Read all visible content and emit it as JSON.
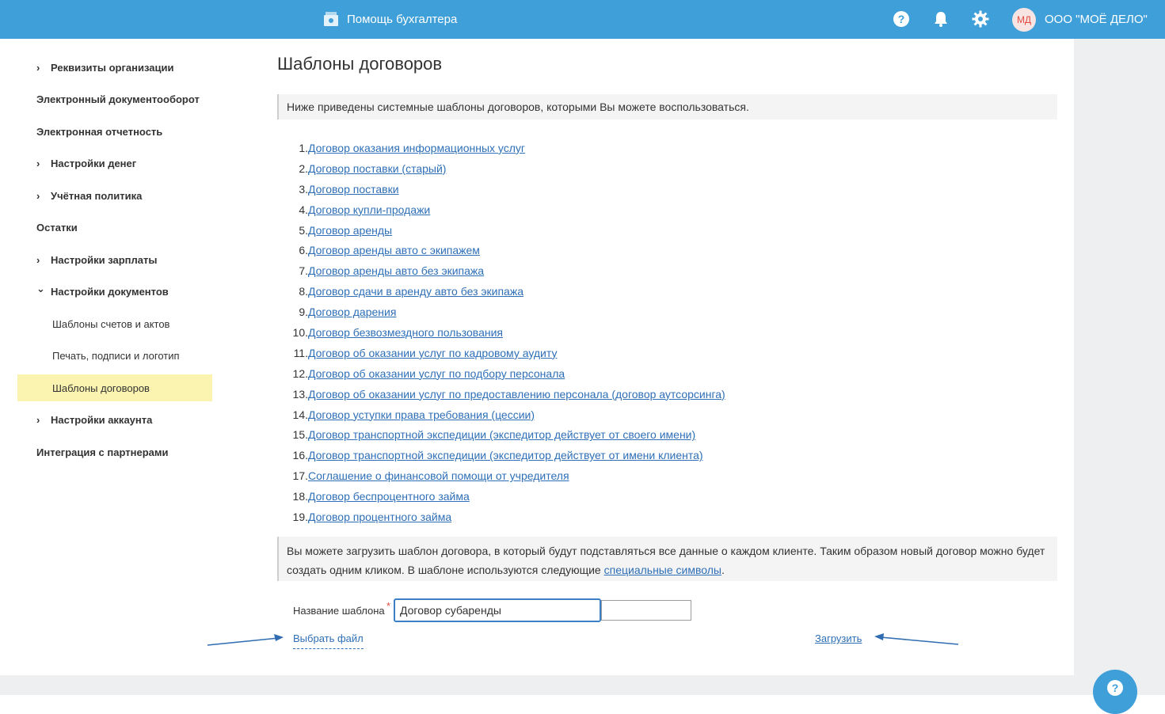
{
  "header": {
    "help_label": "Помощь бухгалтера",
    "avatar_text": "МД",
    "org_name": "ООО \"МОЁ ДЕЛО\"",
    "icons": [
      "help-book-icon",
      "question-circle-icon",
      "bell-icon",
      "gear-icon"
    ],
    "accent": "#3f9fd9"
  },
  "sidebar": {
    "items": [
      {
        "label": "Реквизиты организации",
        "kind": "group"
      },
      {
        "label": "Электронный документооборот",
        "kind": "top"
      },
      {
        "label": "Электронная отчетность",
        "kind": "top"
      },
      {
        "label": "Настройки денег",
        "kind": "group"
      },
      {
        "label": "Учётная политика",
        "kind": "group"
      },
      {
        "label": "Остатки",
        "kind": "top"
      },
      {
        "label": "Настройки зарплаты",
        "kind": "group"
      },
      {
        "label": "Настройки документов",
        "kind": "group-open"
      },
      {
        "label": "Шаблоны счетов и актов",
        "kind": "sub"
      },
      {
        "label": "Печать, подписи и логотип",
        "kind": "sub"
      },
      {
        "label": "Шаблоны договоров",
        "kind": "sub-active"
      },
      {
        "label": "Настройки аккаунта",
        "kind": "group"
      },
      {
        "label": "Интеграция с партнерами",
        "kind": "top"
      }
    ],
    "active_color": "#fbf4b0"
  },
  "main": {
    "title": "Шаблоны договоров",
    "intro": "Ниже приведены системные шаблоны договоров, которыми Вы можете воспользоваться.",
    "contracts": [
      {
        "num": "1.",
        "label": "Договор оказания информационных услуг"
      },
      {
        "num": "2.",
        "label": "Договор поставки (старый)"
      },
      {
        "num": "3.",
        "label": "Договор поставки"
      },
      {
        "num": "4.",
        "label": "Договор купли-продажи"
      },
      {
        "num": "5.",
        "label": "Договор аренды"
      },
      {
        "num": "6.",
        "label": "Договор аренды авто с экипажем"
      },
      {
        "num": "7.",
        "label": "Договор аренды авто без экипажа"
      },
      {
        "num": "8.",
        "label": "Договор сдачи в аренду авто без экипажа"
      },
      {
        "num": "9.",
        "label": "Договор дарения"
      },
      {
        "num": "10.",
        "label": "Договор безвозмездного пользования"
      },
      {
        "num": "11.",
        "label": "Договор об оказании услуг по кадровому аудиту"
      },
      {
        "num": "12.",
        "label": "Договор об оказании услуг по подбору персонала"
      },
      {
        "num": "13.",
        "label": "Договор об оказании услуг по предоставлению персонала (договор аутсорсинга)"
      },
      {
        "num": "14.",
        "label": "Договор уступки права требования (цессии)"
      },
      {
        "num": "15.",
        "label": "Договор транспортной экспедиции (экспедитор действует от своего имени)"
      },
      {
        "num": "16.",
        "label": "Договор транспортной экспедиции (экспедитор действует от имени клиента)"
      },
      {
        "num": "17.",
        "label": "Соглашение о финансовой помощи от учредителя"
      },
      {
        "num": "18.",
        "label": "Договор беспроцентного займа"
      },
      {
        "num": "19.",
        "label": "Договор процентного займа"
      }
    ],
    "upload_info_text": "Вы можете загрузить шаблон договора, в который будут подставляться все данные о каждом клиенте. Таким образом новый договор можно будет создать одним кликом. В шаблоне используются следующие ",
    "upload_info_link": "специальные символы",
    "upload_info_end": ".",
    "form": {
      "name_label": "Название шаблона",
      "required_mark": "*",
      "name_value": "Договор субаренды",
      "choose_file_label": "Выбрать файл",
      "upload_label": "Загрузить"
    },
    "link_color": "#2e6fb7"
  }
}
